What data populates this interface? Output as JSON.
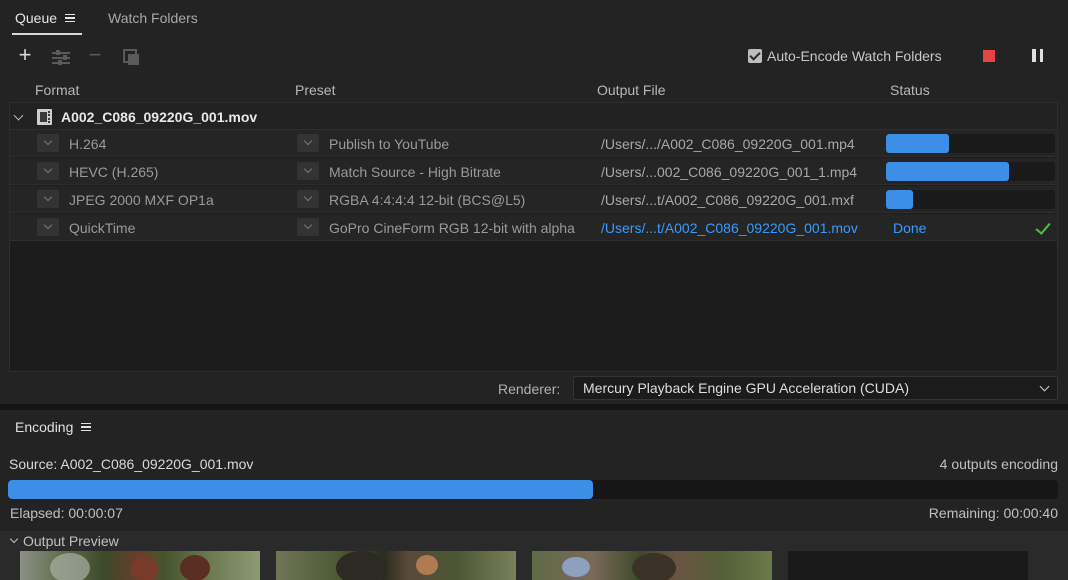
{
  "tabs": {
    "queue": "Queue",
    "watch_folders": "Watch Folders"
  },
  "toolbar": {
    "add": "+",
    "remove": "−"
  },
  "auto_encode": {
    "label": "Auto-Encode Watch Folders",
    "checked": true
  },
  "columns": {
    "format": "Format",
    "preset": "Preset",
    "output_file": "Output File",
    "status": "Status"
  },
  "source": {
    "name": "A002_C086_09220G_001.mov",
    "outputs": [
      {
        "format": "H.264",
        "preset": "Publish to YouTube",
        "output_file": "/Users/.../A002_C086_09220G_001.mp4",
        "progress": 0.37,
        "status": ""
      },
      {
        "format": "HEVC (H.265)",
        "preset": "Match Source - High Bitrate",
        "output_file": "/Users/...002_C086_09220G_001_1.mp4",
        "progress": 0.73,
        "status": ""
      },
      {
        "format": "JPEG 2000 MXF OP1a",
        "preset": "RGBA 4:4:4:4 12-bit (BCS@L5)",
        "output_file": "/Users/...t/A002_C086_09220G_001.mxf",
        "progress": 0.16,
        "status": ""
      },
      {
        "format": "QuickTime",
        "preset": "GoPro CineForm RGB 12-bit with alpha",
        "output_file": "/Users/...t/A002_C086_09220G_001.mov",
        "progress": 1.0,
        "status": "Done"
      }
    ]
  },
  "renderer": {
    "label": "Renderer:",
    "value": "Mercury Playback Engine GPU Acceleration (CUDA)"
  },
  "encoding": {
    "title": "Encoding",
    "source_label": "Source: A002_C086_09220G_001.mov",
    "outputs_count": "4 outputs encoding",
    "progress": 0.557,
    "elapsed": "Elapsed: 00:00:07",
    "remaining": "Remaining: 00:00:40",
    "preview_label": "Output Preview"
  },
  "colors": {
    "accent": "#3d8ee6",
    "link": "#3b9aff",
    "stop": "#e64444",
    "done_check": "#4cc04c"
  }
}
